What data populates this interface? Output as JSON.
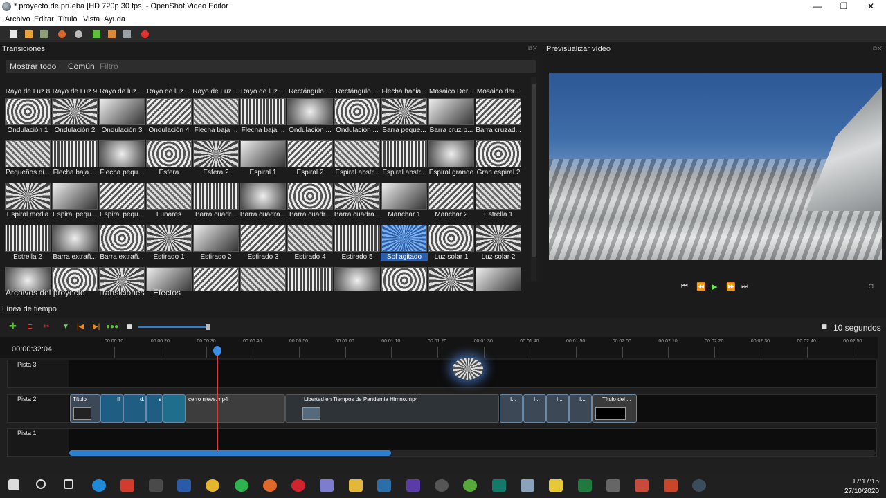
{
  "window": {
    "title": "* proyecto de prueba [HD 720p 30 fps] - OpenShot Video Editor",
    "min": "—",
    "max": "❐",
    "close": "✕"
  },
  "menu": [
    "Archivo",
    "Editar",
    "Título",
    "Vista",
    "Ayuda"
  ],
  "panels": {
    "transitions": "Transiciones",
    "preview": "Previsualizar vídeo",
    "timeline": "Línea de tiempo"
  },
  "filter": {
    "show_all": "Mostrar todo",
    "common": "Común",
    "placeholder": "Filtro"
  },
  "transitions": [
    [
      "Rayo de Luz 8",
      "Rayo de Luz 9",
      "Rayo de luz ...",
      "Rayo de luz ...",
      "Rayo de Luz ...",
      "Rayo de luz ...",
      "Rectángulo ...",
      "Rectángulo ...",
      "Flecha hacia...",
      "Mosaico Der...",
      "Mosaico der..."
    ],
    [
      "Ondulación 1",
      "Ondulación 2",
      "Ondulación 3",
      "Ondulación 4",
      "Flecha baja ...",
      "Flecha baja ...",
      "Ondulación ...",
      "Ondulación ...",
      "Barra peque...",
      "Barra cruz p...",
      "Barra cruzad..."
    ],
    [
      "Pequeños di...",
      "Flecha baja ...",
      "Flecha pequ...",
      "Esfera",
      "Esfera 2",
      "Espiral 1",
      "Espiral 2",
      "Espiral abstr...",
      "Espiral abstr...",
      "Espiral grande",
      "Gran espiral 2"
    ],
    [
      "Espiral media",
      "Espiral pequ...",
      "Espiral pequ...",
      "Lunares",
      "Barra cuadr...",
      "Barra cuadra...",
      "Barra cuadr...",
      "Barra cuadra...",
      "Manchar 1",
      "Manchar 2",
      "Estrella 1"
    ],
    [
      "Estrella 2",
      "Barra extrañ...",
      "Barra extrañ...",
      "Estirado 1",
      "Estirado 2",
      "Estirado 3",
      "Estirado 4",
      "Estirado 5",
      "Sol agitado",
      "Luz solar 1",
      "Luz solar 2"
    ]
  ],
  "selected_transition": "Sol agitado",
  "bottom_tabs": [
    "Archivos del proyecto",
    "Transiciones",
    "Efectos"
  ],
  "transport": {
    "start": "⏮",
    "rewind": "⏪",
    "play": "▶",
    "forward": "⏩",
    "end": "⏭"
  },
  "timeline": {
    "current_time": "00:00:32:04",
    "zoom_label": "10 segundos",
    "ticks": [
      "00:00:10",
      "00:00:20",
      "00:00:30",
      "00:00:40",
      "00:00:50",
      "00:01:00",
      "00:01:10",
      "00:01:20",
      "00:01:30",
      "00:01:40",
      "00:01:50",
      "00:02:00",
      "00:02:10",
      "00:02:20",
      "00:02:30",
      "00:02:40",
      "00:02:50"
    ],
    "tracks": [
      "Pista 3",
      "Pista 2",
      "Pista 1"
    ],
    "clips": [
      "Título",
      "fl",
      "d.",
      "s",
      "cerro nieve.mp4",
      "Libertad en Tiempos de Pandemia Himno.mp4",
      "I...",
      "I...",
      "I...",
      "I...",
      "Título del ..."
    ]
  },
  "taskbar": {
    "time": "17:17:15",
    "date": "27/10/2020"
  }
}
